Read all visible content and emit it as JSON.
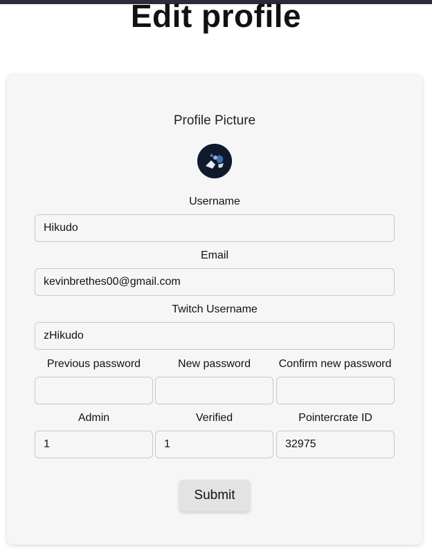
{
  "header": {
    "title": "Edit profile"
  },
  "profile_picture": {
    "title": "Profile Picture"
  },
  "fields": {
    "username": {
      "label": "Username",
      "value": "Hikudo"
    },
    "email": {
      "label": "Email",
      "value": "kevinbrethes00@gmail.com"
    },
    "twitch": {
      "label": "Twitch Username",
      "value": "zHikudo"
    },
    "previous_password": {
      "label": "Previous password",
      "value": ""
    },
    "new_password": {
      "label": "New password",
      "value": ""
    },
    "confirm_password": {
      "label": "Confirm new password",
      "value": ""
    },
    "admin": {
      "label": "Admin",
      "value": "1"
    },
    "verified": {
      "label": "Verified",
      "value": "1"
    },
    "pointercrate_id": {
      "label": "Pointercrate ID",
      "value": "32975"
    }
  },
  "submit": {
    "label": "Submit"
  },
  "colors": {
    "card_background": "#f6f6f6",
    "button_background": "#e3e3e3",
    "top_bar": "#2b2b3a"
  }
}
